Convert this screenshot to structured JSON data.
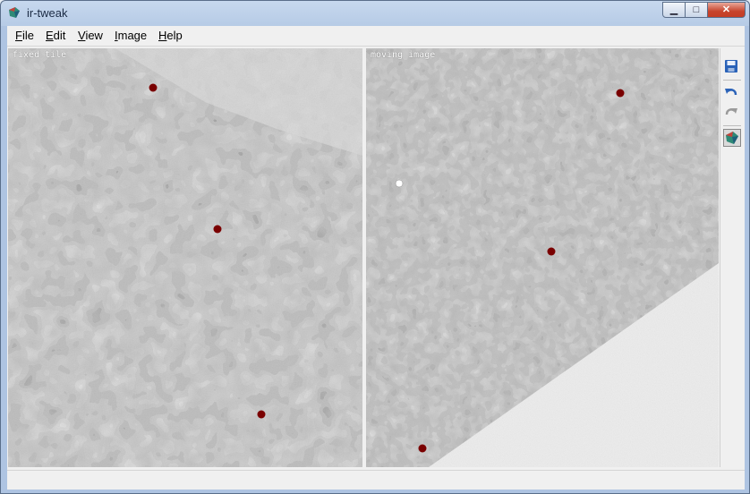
{
  "window": {
    "title": "ir-tweak"
  },
  "title_buttons": {
    "minimize": "▁",
    "maximize": "□",
    "close": "✕"
  },
  "menu": [
    {
      "hotkey": "F",
      "rest": "ile"
    },
    {
      "hotkey": "E",
      "rest": "dit"
    },
    {
      "hotkey": "V",
      "rest": "iew"
    },
    {
      "hotkey": "I",
      "rest": "mage"
    },
    {
      "hotkey": "H",
      "rest": "elp"
    }
  ],
  "viewers": {
    "fixed": {
      "label": "fixed tile"
    },
    "moving": {
      "label": "moving image"
    }
  },
  "toolbar": {
    "save": "save-icon",
    "undo": "undo-icon",
    "redo": "redo-icon",
    "app": "app-icon"
  },
  "status": {
    "text": ""
  },
  "colors": {
    "marker": "#7a0000",
    "marker_selected": "#ffffff"
  }
}
